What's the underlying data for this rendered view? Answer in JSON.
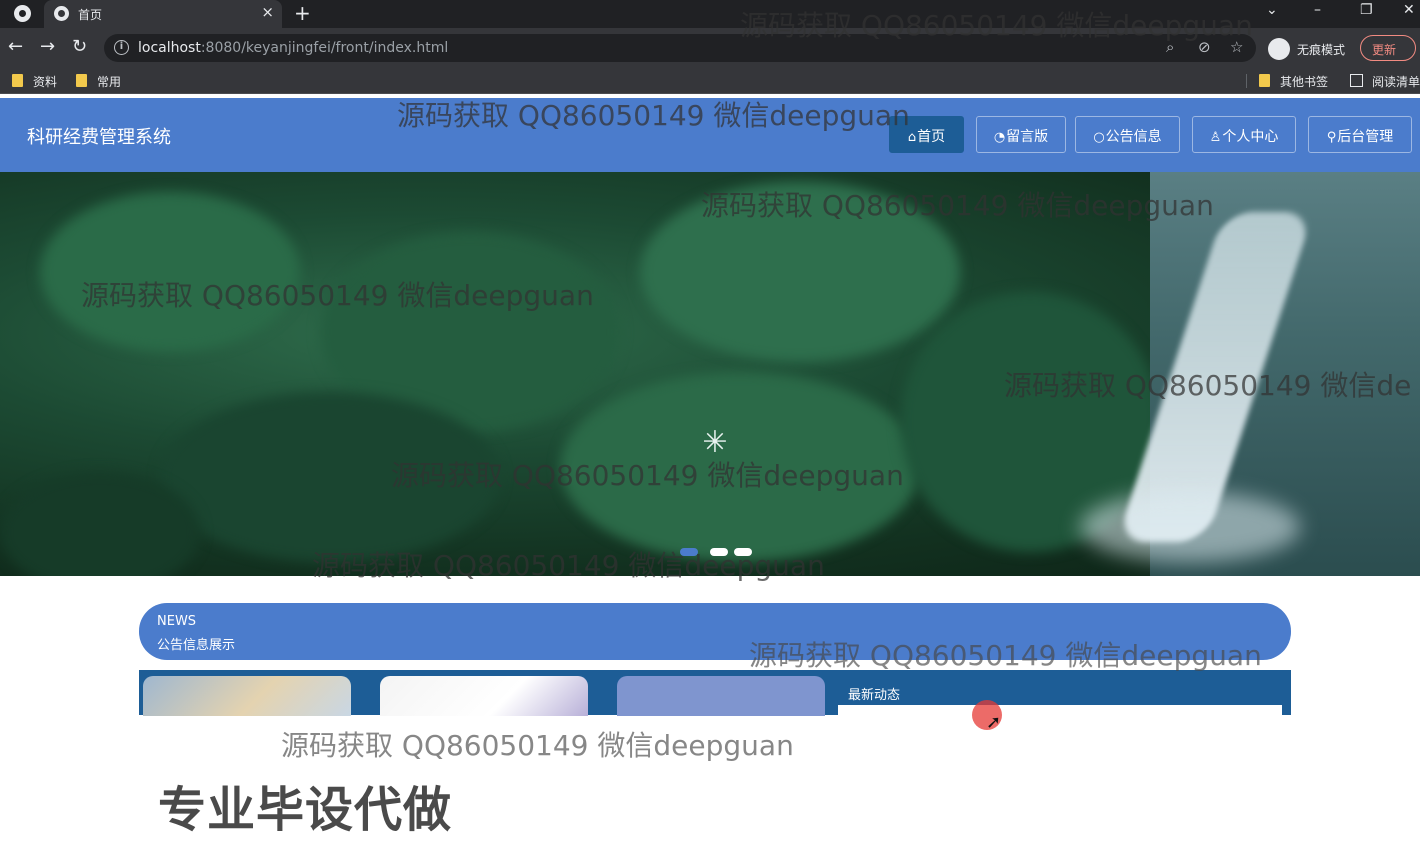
{
  "browser": {
    "tab_title": "首页",
    "tab_close": "×",
    "new_tab": "+",
    "url_host": "localhost",
    "url_rest": ":8080/keyanjingfei/front/index.html",
    "incognito_label": "无痕模式",
    "update_label": "更新",
    "bookmarks": [
      "资料",
      "常用"
    ],
    "other_bookmarks": "其他书签",
    "reading_list": "阅读清单",
    "win_minimize": "–",
    "win_restore": "❐",
    "win_close": "✕",
    "tab_search": "⌄",
    "icons": [
      "back-icon",
      "forward-icon",
      "reload-icon",
      "zoom-icon",
      "eye-off-icon",
      "star-icon",
      "menu-icon"
    ]
  },
  "site": {
    "title": "科研经费管理系统",
    "nav": [
      {
        "label": "首页",
        "glyph": "⌂",
        "active": true
      },
      {
        "label": "留言版",
        "glyph": "◔",
        "active": false
      },
      {
        "label": "公告信息",
        "glyph": "○",
        "active": false
      },
      {
        "label": "个人中心",
        "glyph": "♙",
        "active": false
      },
      {
        "label": "后台管理",
        "glyph": "⚲",
        "active": false
      }
    ],
    "banner": {
      "slide_count": 3,
      "active_slide": 1,
      "loader_glyph": "✳"
    },
    "news": {
      "label_en": "NEWS",
      "label_cn": "公告信息展示",
      "latest_title": "最新动态"
    },
    "colors": {
      "primary": "#4b7ccc",
      "active_nav": "#1d5d96"
    }
  },
  "overlay": {
    "watermark": "源码获取 QQ86050149 微信deepguan",
    "watermark_partial": "源码获取 QQ86050149 微信de",
    "ad_text": "专业毕设代做"
  }
}
